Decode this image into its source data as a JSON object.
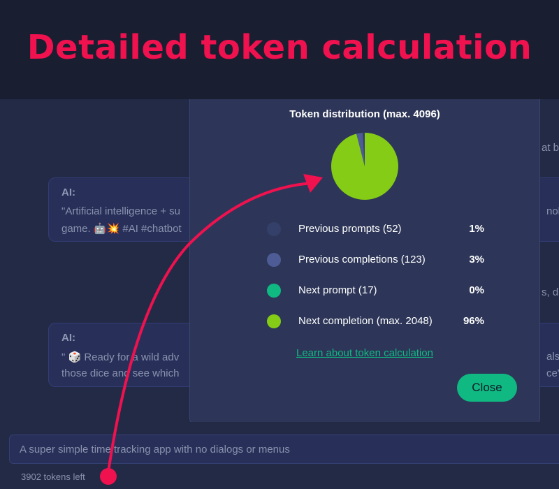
{
  "banner": {
    "title": "Detailed token calculation"
  },
  "chat": {
    "ai_label": "AI:",
    "message_1": {
      "line_1_left": "\"Artificial intelligence + su",
      "line_1_right": "nolo",
      "line_2": "game. 🤖💥 #AI #chatbot"
    },
    "message_2": {
      "line_1_left": "\" 🎲 Ready for a wild adv",
      "line_1_right": "als a",
      "line_2_left": "those dice and see which",
      "line_2_right": "ce\""
    },
    "user_fragment_1": "at b",
    "user_fragment_2": "s, dic"
  },
  "modal": {
    "title": "Token distribution (max. 4096)",
    "legend": [
      {
        "label": "Previous prompts (52)",
        "percent": "1%",
        "color": "#35406a"
      },
      {
        "label": "Previous completions (123)",
        "percent": "3%",
        "color": "#4e5c95"
      },
      {
        "label": "Next prompt (17)",
        "percent": "0%",
        "color": "#10b981"
      },
      {
        "label": "Next completion (max. 2048)",
        "percent": "96%",
        "color": "#84cc16"
      }
    ],
    "learn_link": "Learn about token calculation",
    "close_label": "Close"
  },
  "chart_data": {
    "type": "pie",
    "title": "Token distribution (max. 4096)",
    "slices": [
      {
        "name": "Previous prompts (52)",
        "percent": 1,
        "color": "#35406a"
      },
      {
        "name": "Previous completions (123)",
        "percent": 3,
        "color": "#4e5c95"
      },
      {
        "name": "Next prompt (17)",
        "percent": 0,
        "color": "#10b981"
      },
      {
        "name": "Next completion (max. 2048)",
        "percent": 96,
        "color": "#84cc16"
      }
    ]
  },
  "composer": {
    "placeholder": "A super simple time tracking app with no dialogs or menus",
    "tokens_left": "3902 tokens left"
  },
  "colors": {
    "accent": "#f0114f",
    "primary": "#10b981",
    "completion": "#84cc16"
  }
}
